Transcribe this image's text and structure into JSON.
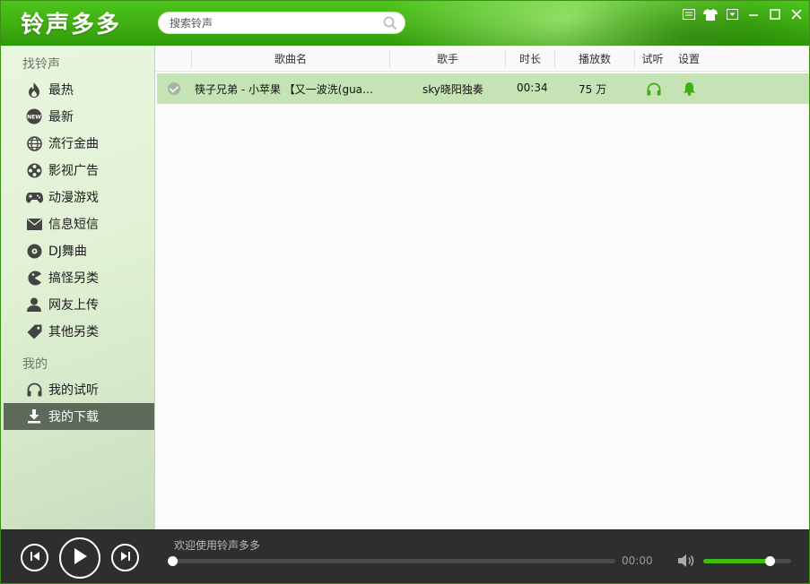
{
  "app": {
    "logo": "铃声多多"
  },
  "search": {
    "placeholder": "搜索铃声"
  },
  "window_controls": [
    "window-menu-icon",
    "skin-shirt-icon",
    "dropdown-icon",
    "minimize-icon",
    "maximize-icon",
    "close-icon"
  ],
  "sidebar": {
    "section1": "找铃声",
    "items": [
      {
        "label": "最热",
        "icon": "fire-icon"
      },
      {
        "label": "最新",
        "icon": "new-badge-icon"
      },
      {
        "label": "流行金曲",
        "icon": "globe-icon"
      },
      {
        "label": "影视广告",
        "icon": "film-reel-icon"
      },
      {
        "label": "动漫游戏",
        "icon": "gamepad-icon"
      },
      {
        "label": "信息短信",
        "icon": "envelope-icon"
      },
      {
        "label": "DJ舞曲",
        "icon": "disc-icon"
      },
      {
        "label": "搞怪另类",
        "icon": "pacman-icon"
      },
      {
        "label": "网友上传",
        "icon": "user-icon"
      },
      {
        "label": "其他另类",
        "icon": "tag-icon"
      }
    ],
    "section2": "我的",
    "my_items": [
      {
        "label": "我的试听",
        "icon": "headphones-icon"
      },
      {
        "label": "我的下载",
        "icon": "download-icon",
        "active": true
      }
    ]
  },
  "table": {
    "headers": {
      "name": "歌曲名",
      "artist": "歌手",
      "duration": "时长",
      "plays": "播放数",
      "listen": "试听",
      "settings": "设置"
    },
    "rows": [
      {
        "name": "筷子兄弟 - 小苹果 【又一波洗(gua…",
        "artist": "sky晓阳独奏",
        "duration": "00:34",
        "plays": "75 万"
      }
    ]
  },
  "player": {
    "status": "欢迎使用铃声多多",
    "time": "00:00",
    "progress": 0,
    "volume": 0.75
  },
  "colors": {
    "accent": "#3fbc12",
    "titlebar": "#3fae10",
    "row_selected": "#c5e3b4",
    "sidebar_active": "#5d6a5a",
    "player_bg": "#2e2e2e"
  }
}
